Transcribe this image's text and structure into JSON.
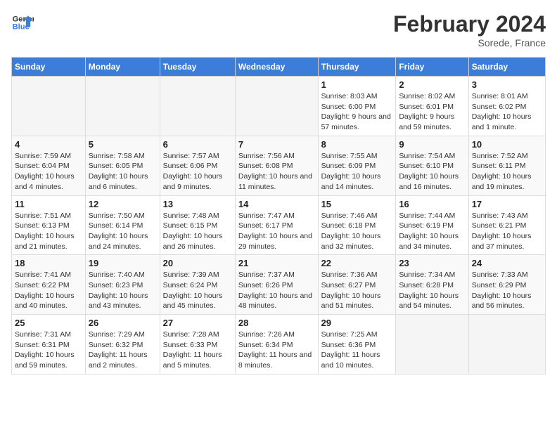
{
  "logo": {
    "line1": "General",
    "line2": "Blue"
  },
  "title": "February 2024",
  "subtitle": "Sorede, France",
  "headers": [
    "Sunday",
    "Monday",
    "Tuesday",
    "Wednesday",
    "Thursday",
    "Friday",
    "Saturday"
  ],
  "weeks": [
    [
      {
        "day": "",
        "info": ""
      },
      {
        "day": "",
        "info": ""
      },
      {
        "day": "",
        "info": ""
      },
      {
        "day": "",
        "info": ""
      },
      {
        "day": "1",
        "info": "Sunrise: 8:03 AM\nSunset: 6:00 PM\nDaylight: 9 hours and 57 minutes."
      },
      {
        "day": "2",
        "info": "Sunrise: 8:02 AM\nSunset: 6:01 PM\nDaylight: 9 hours and 59 minutes."
      },
      {
        "day": "3",
        "info": "Sunrise: 8:01 AM\nSunset: 6:02 PM\nDaylight: 10 hours and 1 minute."
      }
    ],
    [
      {
        "day": "4",
        "info": "Sunrise: 7:59 AM\nSunset: 6:04 PM\nDaylight: 10 hours and 4 minutes."
      },
      {
        "day": "5",
        "info": "Sunrise: 7:58 AM\nSunset: 6:05 PM\nDaylight: 10 hours and 6 minutes."
      },
      {
        "day": "6",
        "info": "Sunrise: 7:57 AM\nSunset: 6:06 PM\nDaylight: 10 hours and 9 minutes."
      },
      {
        "day": "7",
        "info": "Sunrise: 7:56 AM\nSunset: 6:08 PM\nDaylight: 10 hours and 11 minutes."
      },
      {
        "day": "8",
        "info": "Sunrise: 7:55 AM\nSunset: 6:09 PM\nDaylight: 10 hours and 14 minutes."
      },
      {
        "day": "9",
        "info": "Sunrise: 7:54 AM\nSunset: 6:10 PM\nDaylight: 10 hours and 16 minutes."
      },
      {
        "day": "10",
        "info": "Sunrise: 7:52 AM\nSunset: 6:11 PM\nDaylight: 10 hours and 19 minutes."
      }
    ],
    [
      {
        "day": "11",
        "info": "Sunrise: 7:51 AM\nSunset: 6:13 PM\nDaylight: 10 hours and 21 minutes."
      },
      {
        "day": "12",
        "info": "Sunrise: 7:50 AM\nSunset: 6:14 PM\nDaylight: 10 hours and 24 minutes."
      },
      {
        "day": "13",
        "info": "Sunrise: 7:48 AM\nSunset: 6:15 PM\nDaylight: 10 hours and 26 minutes."
      },
      {
        "day": "14",
        "info": "Sunrise: 7:47 AM\nSunset: 6:17 PM\nDaylight: 10 hours and 29 minutes."
      },
      {
        "day": "15",
        "info": "Sunrise: 7:46 AM\nSunset: 6:18 PM\nDaylight: 10 hours and 32 minutes."
      },
      {
        "day": "16",
        "info": "Sunrise: 7:44 AM\nSunset: 6:19 PM\nDaylight: 10 hours and 34 minutes."
      },
      {
        "day": "17",
        "info": "Sunrise: 7:43 AM\nSunset: 6:21 PM\nDaylight: 10 hours and 37 minutes."
      }
    ],
    [
      {
        "day": "18",
        "info": "Sunrise: 7:41 AM\nSunset: 6:22 PM\nDaylight: 10 hours and 40 minutes."
      },
      {
        "day": "19",
        "info": "Sunrise: 7:40 AM\nSunset: 6:23 PM\nDaylight: 10 hours and 43 minutes."
      },
      {
        "day": "20",
        "info": "Sunrise: 7:39 AM\nSunset: 6:24 PM\nDaylight: 10 hours and 45 minutes."
      },
      {
        "day": "21",
        "info": "Sunrise: 7:37 AM\nSunset: 6:26 PM\nDaylight: 10 hours and 48 minutes."
      },
      {
        "day": "22",
        "info": "Sunrise: 7:36 AM\nSunset: 6:27 PM\nDaylight: 10 hours and 51 minutes."
      },
      {
        "day": "23",
        "info": "Sunrise: 7:34 AM\nSunset: 6:28 PM\nDaylight: 10 hours and 54 minutes."
      },
      {
        "day": "24",
        "info": "Sunrise: 7:33 AM\nSunset: 6:29 PM\nDaylight: 10 hours and 56 minutes."
      }
    ],
    [
      {
        "day": "25",
        "info": "Sunrise: 7:31 AM\nSunset: 6:31 PM\nDaylight: 10 hours and 59 minutes."
      },
      {
        "day": "26",
        "info": "Sunrise: 7:29 AM\nSunset: 6:32 PM\nDaylight: 11 hours and 2 minutes."
      },
      {
        "day": "27",
        "info": "Sunrise: 7:28 AM\nSunset: 6:33 PM\nDaylight: 11 hours and 5 minutes."
      },
      {
        "day": "28",
        "info": "Sunrise: 7:26 AM\nSunset: 6:34 PM\nDaylight: 11 hours and 8 minutes."
      },
      {
        "day": "29",
        "info": "Sunrise: 7:25 AM\nSunset: 6:36 PM\nDaylight: 11 hours and 10 minutes."
      },
      {
        "day": "",
        "info": ""
      },
      {
        "day": "",
        "info": ""
      }
    ]
  ]
}
